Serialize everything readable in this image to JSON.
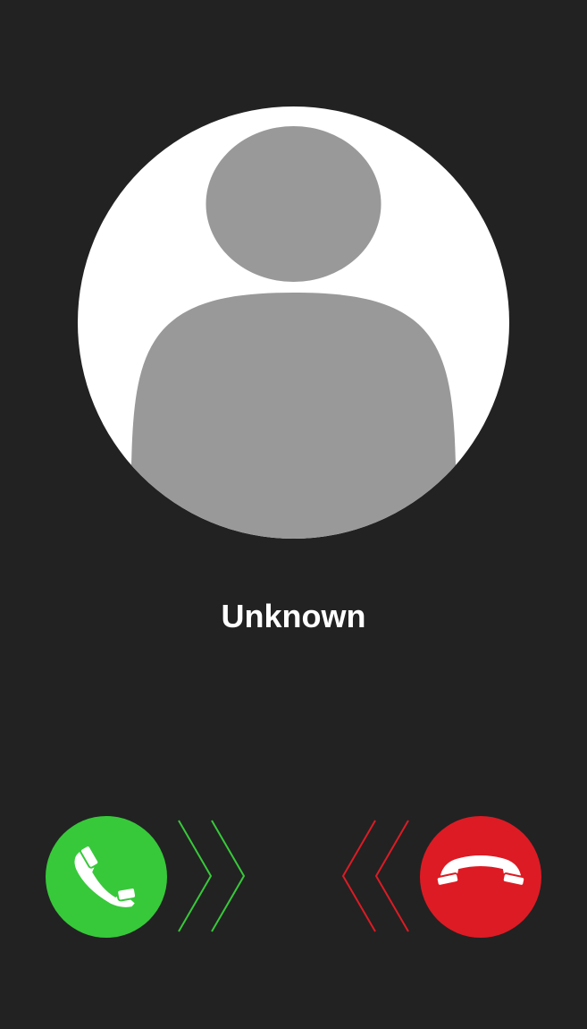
{
  "caller": {
    "name": "Unknown"
  },
  "avatar": {
    "icon": "person-silhouette-icon",
    "background_color": "#ffffff",
    "silhouette_color": "#999999"
  },
  "actions": {
    "accept": {
      "icon": "phone-icon",
      "color": "#37c93a"
    },
    "decline": {
      "icon": "phone-hangup-icon",
      "color": "#dd1b24"
    },
    "swipe_hints": {
      "accept_icon": "chevron-right-icon",
      "decline_icon": "chevron-left-icon"
    }
  },
  "colors": {
    "background": "#222222",
    "text": "#ffffff"
  }
}
